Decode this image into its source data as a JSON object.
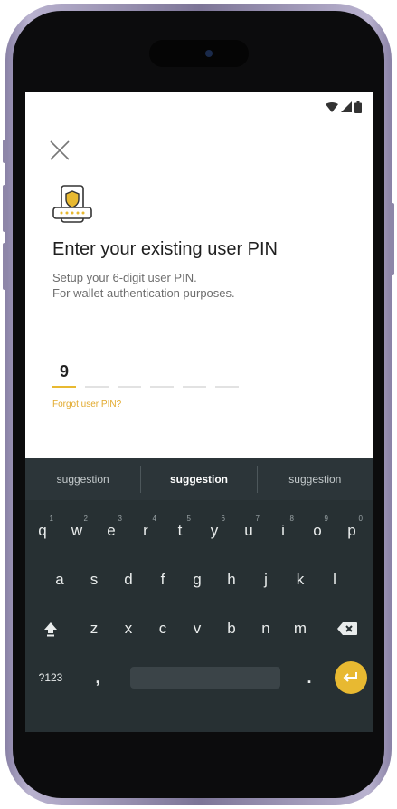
{
  "colors": {
    "accent": "#e8b931",
    "keyboard_bg": "#273033",
    "title": "#1f1f1f",
    "subtitle": "#6e6e6e"
  },
  "header": {
    "close_icon": "close-icon",
    "illustration_icon": "pin-device-shield-icon"
  },
  "content": {
    "title": "Enter your existing user PIN",
    "subtitle_line1": "Setup your 6-digit user PIN.",
    "subtitle_line2": "For wallet authentication purposes.",
    "pin_digits": [
      "9",
      "",
      "",
      "",
      "",
      ""
    ],
    "forgot_link": "Forgot user PIN?"
  },
  "keyboard": {
    "suggestions": [
      "suggestion",
      "suggestion",
      "suggestion"
    ],
    "row1": [
      {
        "key": "q",
        "hint": "1"
      },
      {
        "key": "w",
        "hint": "2"
      },
      {
        "key": "e",
        "hint": "3"
      },
      {
        "key": "r",
        "hint": "4"
      },
      {
        "key": "t",
        "hint": "5"
      },
      {
        "key": "y",
        "hint": "6"
      },
      {
        "key": "u",
        "hint": "7"
      },
      {
        "key": "i",
        "hint": "8"
      },
      {
        "key": "o",
        "hint": "9"
      },
      {
        "key": "p",
        "hint": "0"
      }
    ],
    "row2": [
      "a",
      "s",
      "d",
      "f",
      "g",
      "h",
      "j",
      "k",
      "l"
    ],
    "row3": [
      "z",
      "x",
      "c",
      "v",
      "b",
      "n",
      "m"
    ],
    "symbols_label": "?123",
    "comma_label": ",",
    "period_label": ".",
    "shift_icon": "shift-icon",
    "backspace_icon": "backspace-icon",
    "enter_icon": "enter-icon"
  }
}
